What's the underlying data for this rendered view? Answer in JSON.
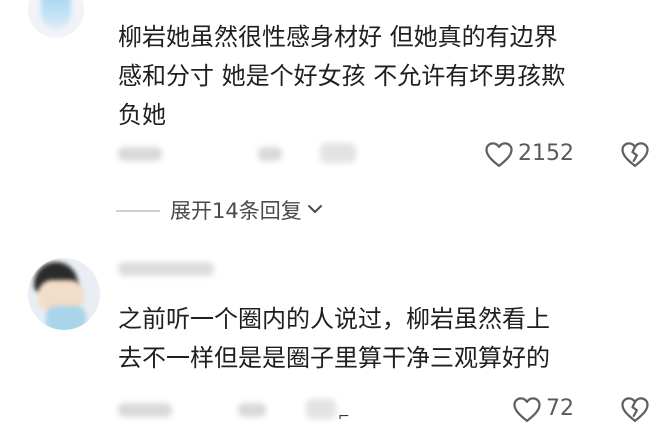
{
  "comments": [
    {
      "lines": [
        "柳岩她虽然很性感身材好 但她真的有边界",
        "感和分寸 她是个好女孩 不允许有坏男孩欺",
        "负她"
      ],
      "like_count": "2152",
      "expand_label": "展开14条回复"
    },
    {
      "lines": [
        "之前听一个圈内的人说过，柳岩虽然看上",
        "去不一样但是是圈子里算干净三观算好的"
      ],
      "like_count": "72"
    }
  ],
  "icons": {
    "like": "heart-outline-icon",
    "dislike": "broken-heart-icon",
    "expand": "chevron-down-icon"
  },
  "colors": {
    "text": "#1f1f1f",
    "meta": "#5a5a5a",
    "icon": "#5f5f5f"
  }
}
